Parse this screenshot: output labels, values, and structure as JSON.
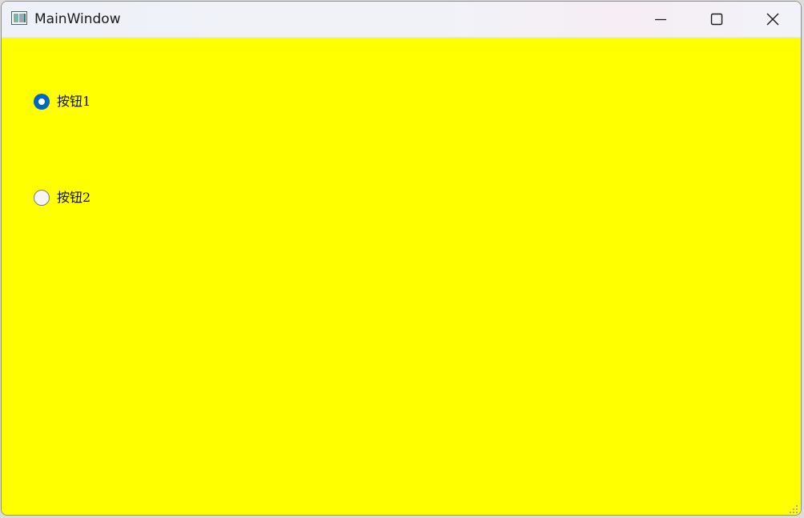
{
  "window": {
    "title": "MainWindow",
    "icon": "app-window-icon",
    "controls": {
      "minimize_icon": "minimize-icon",
      "maximize_icon": "maximize-icon",
      "close_icon": "close-icon"
    }
  },
  "client": {
    "background_color": "#ffff00",
    "radio_buttons": [
      {
        "label": "按钮1",
        "checked": true
      },
      {
        "label": "按钮2",
        "checked": false
      }
    ]
  },
  "colors": {
    "accent": "#0067c0"
  }
}
